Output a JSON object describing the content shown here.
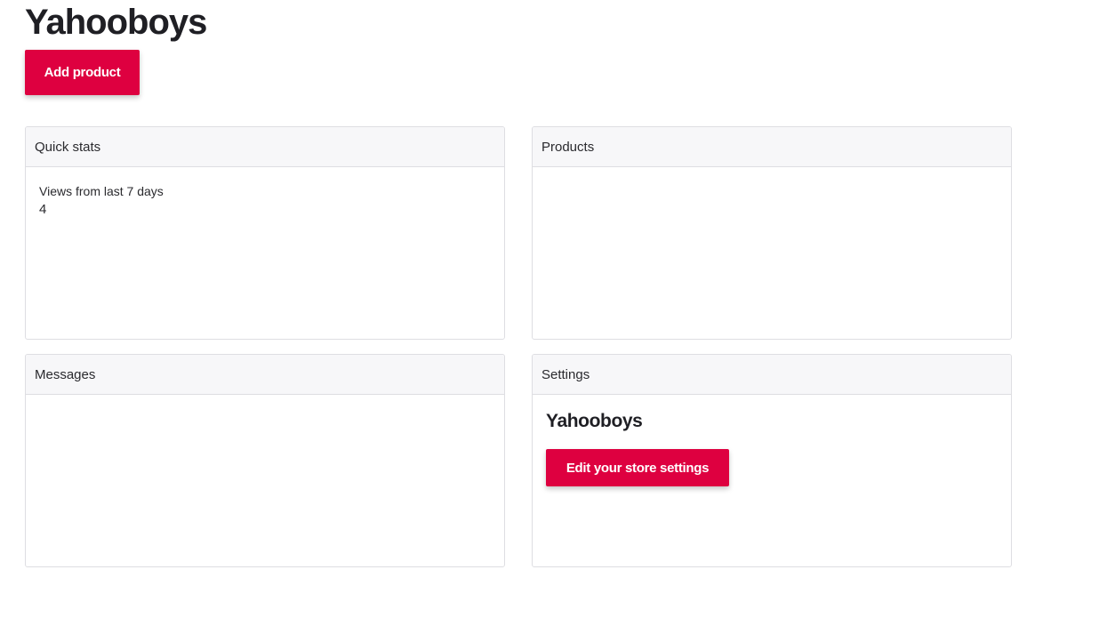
{
  "store": {
    "name": "Yahooboys"
  },
  "actions": {
    "add_product_label": "Add product"
  },
  "cards": {
    "quick_stats": {
      "title": "Quick stats",
      "views_label": "Views from last 7 days",
      "views_value": "4"
    },
    "products": {
      "title": "Products"
    },
    "messages": {
      "title": "Messages"
    },
    "settings": {
      "title": "Settings",
      "store_name": "Yahooboys",
      "edit_label": "Edit your store settings"
    }
  },
  "colors": {
    "accent": "#de0040",
    "card_header_bg": "#f7f7f9",
    "border": "#dedee2"
  }
}
